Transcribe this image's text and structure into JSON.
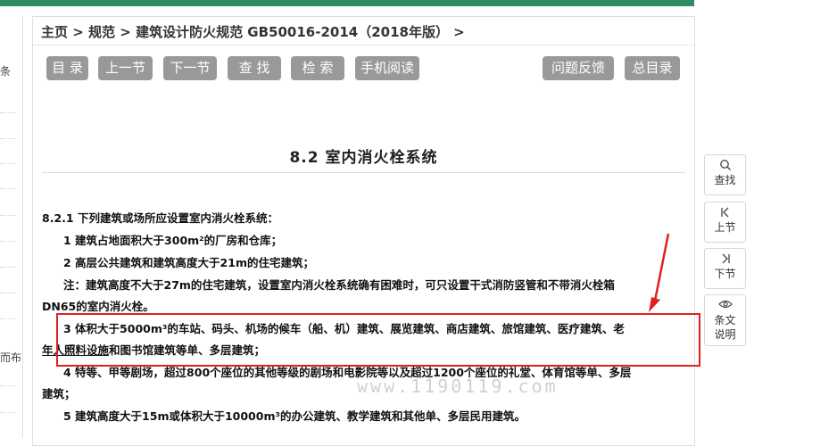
{
  "left_panel": {
    "fragment_top": "条",
    "fragment_mid": "而布"
  },
  "breadcrumb": {
    "home": "主页",
    "sep1": " > ",
    "section": "规范",
    "sep2": " > ",
    "doc": "建筑设计防火规范 GB50016-2014（2018年版）",
    "sep3": " >"
  },
  "toolbar": {
    "contents": "目 录",
    "prev": "上一节",
    "next": "下一节",
    "find": "查 找",
    "search": "检 索",
    "mobile": "手机阅读",
    "feedback": "问题反馈",
    "index": "总目录"
  },
  "section_title": "8.2  室内消火栓系统",
  "content": {
    "p1": "8.2.1 下列建筑或场所应设置室内消火栓系统：",
    "p2": "1 建筑占地面积大于300m²的厂房和仓库；",
    "p3": "2 高层公共建筑和建筑高度大于21m的住宅建筑；",
    "p4": "注：建筑高度不大于27m的住宅建筑，设置室内消火栓系统确有困难时，可只设置干式消防竖管和不带消火栓箱",
    "p5": "DN65的室内消火栓。",
    "p6": "3 体积大于5000m³的车站、码头、机场的候车（船、机）建筑、展览建筑、商店建筑、旅馆建筑、医疗建筑、老",
    "p7a": "年人照料设施",
    "p7b": "和图书馆建筑等单、多层建筑；",
    "p8": "4 特等、甲等剧场，超过800个座位的其他等级的剧场和电影院等以及超过1200个座位的礼堂、体育馆等单、多层",
    "p9": "建筑；",
    "p10": "5 建筑高度大于15m或体积大于10000m³的办公建筑、教学建筑和其他单、多层民用建筑。"
  },
  "watermark": "www.1190119.com",
  "side_tools": {
    "find": "查找",
    "prev": "上节",
    "next": "下节",
    "note1": "条文",
    "note2": "说明"
  },
  "colors": {
    "accent": "#2e8b66",
    "button": "#999999",
    "highlight": "#e02020"
  }
}
